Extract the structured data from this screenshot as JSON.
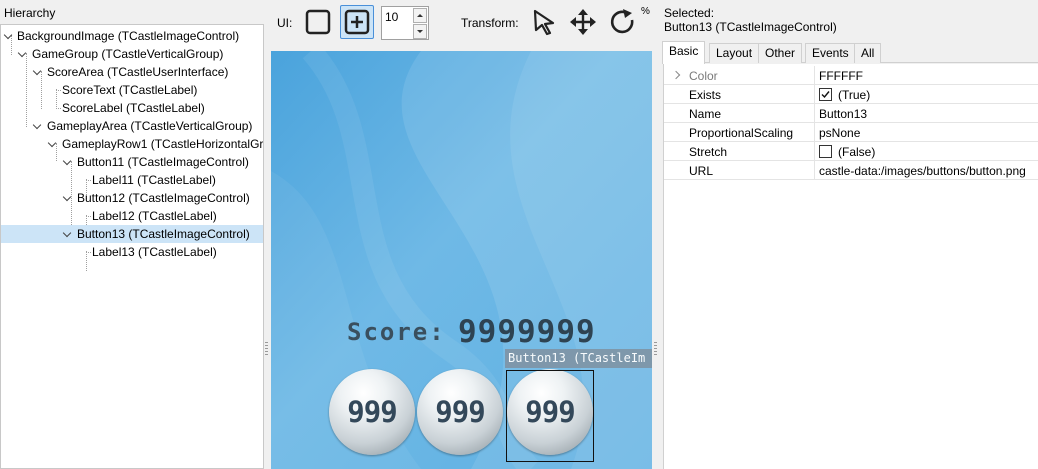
{
  "hierarchy": {
    "title": "Hierarchy",
    "items": [
      {
        "label": "BackgroundImage (TCastleImageControl)"
      },
      {
        "label": "GameGroup (TCastleVerticalGroup)"
      },
      {
        "label": "ScoreArea (TCastleUserInterface)"
      },
      {
        "label": "ScoreText (TCastleLabel)"
      },
      {
        "label": "ScoreLabel (TCastleLabel)"
      },
      {
        "label": "GameplayArea (TCastleVerticalGroup)"
      },
      {
        "label": "GameplayRow1 (TCastleHorizontalGro"
      },
      {
        "label": "Button11 (TCastleImageControl)"
      },
      {
        "label": "Label11 (TCastleLabel)"
      },
      {
        "label": "Button12 (TCastleImageControl)"
      },
      {
        "label": "Label12 (TCastleLabel)"
      },
      {
        "label": "Button13 (TCastleImageControl)"
      },
      {
        "label": "Label13 (TCastleLabel)"
      }
    ],
    "selected_index": 11
  },
  "toolbar": {
    "ui_label": "UI:",
    "spin_value": "10",
    "transform_label": "Transform:",
    "percent_fragment": "%",
    "icons": [
      "square-icon",
      "add-square-icon",
      "select-arrow-icon",
      "move-icon",
      "rotate-icon"
    ]
  },
  "viewport": {
    "score_text": "Score:",
    "score_value": "9999999",
    "buttons": [
      {
        "label": "999"
      },
      {
        "label": "999"
      },
      {
        "label": "999"
      }
    ],
    "selection_tag": "Button13 (TCastleIm"
  },
  "inspector": {
    "selected_caption": "Selected:",
    "selected_name": "Button13 (TCastleImageControl)",
    "tabs": [
      {
        "label": "Basic",
        "active": true
      },
      {
        "label": "Layout"
      },
      {
        "label": "Other"
      },
      {
        "label": "Events"
      },
      {
        "label": "All"
      }
    ],
    "properties": [
      {
        "name": "Color",
        "value": "FFFFFF"
      },
      {
        "name": "Exists",
        "value": "(True)",
        "checked": true
      },
      {
        "name": "Name",
        "value": "Button13"
      },
      {
        "name": "ProportionalScaling",
        "value": "psNone"
      },
      {
        "name": "Stretch",
        "value": "(False)",
        "checked": false
      },
      {
        "name": "URL",
        "value": "castle-data:/images/buttons/button.png"
      }
    ]
  },
  "colors": {
    "selection_highlight": "#cce4f7",
    "viewport_blue": "#6cb4e4",
    "score_text": "#3a4f5e"
  }
}
